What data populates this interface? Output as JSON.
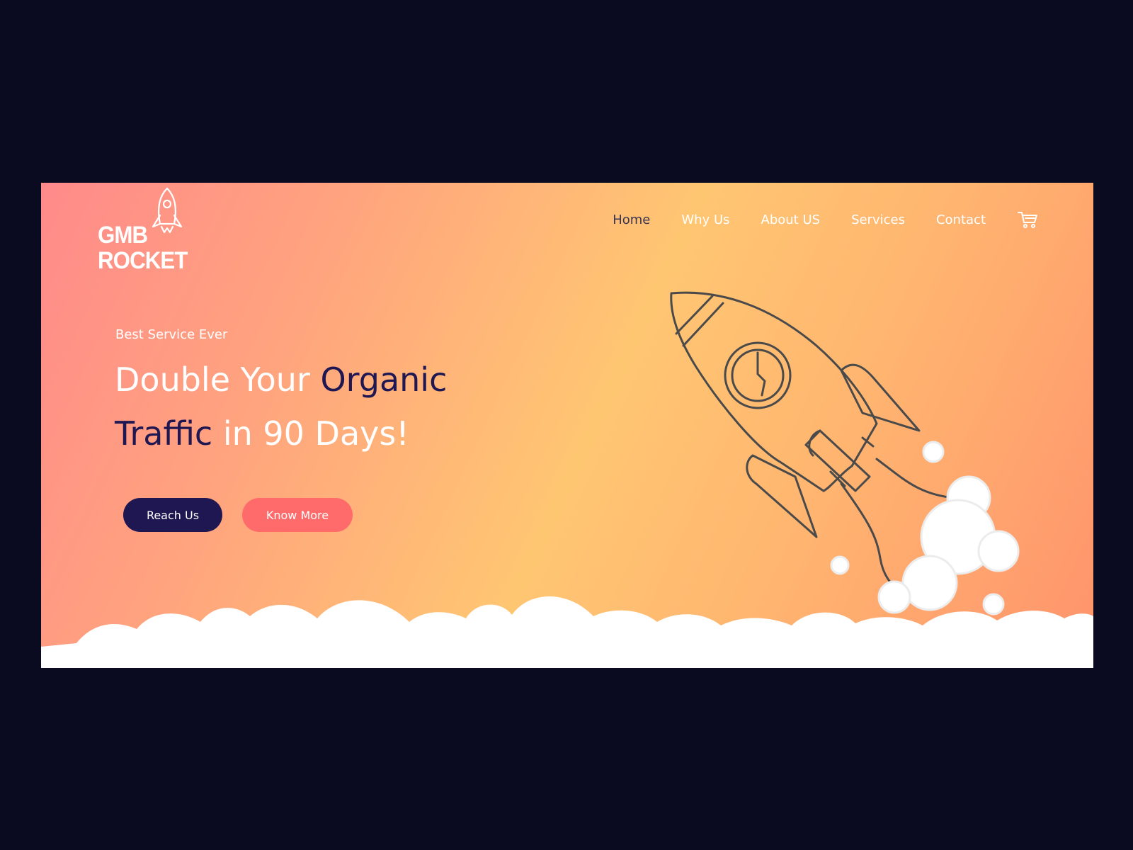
{
  "logo": {
    "line1": "GMB",
    "line2": "ROCKET"
  },
  "nav": {
    "items": [
      {
        "label": "Home",
        "active": true
      },
      {
        "label": "Why Us"
      },
      {
        "label": "About US"
      },
      {
        "label": "Services"
      },
      {
        "label": "Contact"
      }
    ],
    "cart_icon": "cart-icon"
  },
  "hero": {
    "eyebrow": "Best Service Ever",
    "headline": {
      "part1": "Double Your ",
      "part2": "Organic",
      "part3": "Traffic",
      "part4": " in 90 Days!"
    },
    "buttons": {
      "primary": "Reach Us",
      "secondary": "Know More"
    }
  },
  "colors": {
    "page_background": "#0a0b21",
    "gradient": [
      "#ff8a8a",
      "#ffa47e",
      "#ffc672",
      "#ffb570",
      "#ff936c"
    ],
    "dark_accent": "#1f1752",
    "coral_accent": "#ff6b6b",
    "rocket_stroke": "#4a4a4a",
    "clouds": "#ffffff"
  },
  "icons": [
    "rocket-logo-icon",
    "cart-icon",
    "rocket-illustration"
  ]
}
